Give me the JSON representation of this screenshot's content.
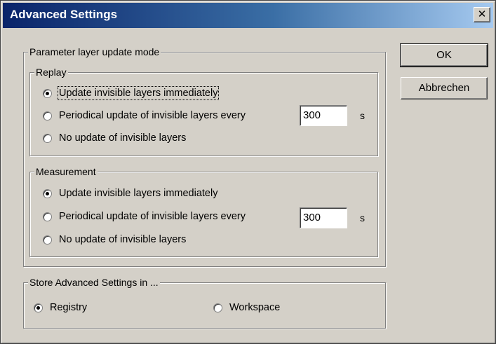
{
  "dialog": {
    "title": "Advanced Settings",
    "close_glyph": "✕"
  },
  "parameter_group": {
    "label": "Parameter layer update mode",
    "replay": {
      "label": "Replay",
      "options": [
        {
          "label": "Update invisible layers immediately",
          "selected": true
        },
        {
          "label": "Periodical update of invisible layers every",
          "selected": false
        },
        {
          "label": "No update of invisible layers",
          "selected": false
        }
      ],
      "interval_value": "300",
      "interval_unit": "s"
    },
    "measurement": {
      "label": "Measurement",
      "options": [
        {
          "label": "Update invisible layers immediately",
          "selected": true
        },
        {
          "label": "Periodical update of invisible layers every",
          "selected": false
        },
        {
          "label": "No update of invisible layers",
          "selected": false
        }
      ],
      "interval_value": "300",
      "interval_unit": "s"
    }
  },
  "store_group": {
    "label": "Store Advanced Settings in ...",
    "options": [
      {
        "label": "Registry",
        "selected": true
      },
      {
        "label": "Workspace",
        "selected": false
      }
    ]
  },
  "buttons": {
    "ok_label": "OK",
    "cancel_label": "Abbrechen"
  }
}
